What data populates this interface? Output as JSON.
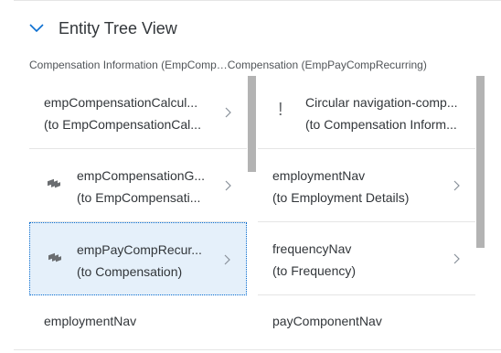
{
  "panel": {
    "title": "Entity Tree View",
    "breadcrumb": "Compensation Information (EmpComp…Compensation (EmpPayCompRecurring)"
  },
  "left_items": [
    {
      "line1": "empCompensationCalcul...",
      "line2": "(to EmpCompensationCal...",
      "icon": "none"
    },
    {
      "line1": "empCompensationG...",
      "line2": "(to EmpCompensati...",
      "icon": "hierarchy-icon"
    },
    {
      "line1": "empPayCompRecur...",
      "line2": "(to Compensation)",
      "icon": "hierarchy-icon",
      "selected": true
    }
  ],
  "right_items": [
    {
      "line1": "Circular navigation-comp...",
      "line2": "(to Compensation Inform...",
      "icon": "warning-exclamation-icon"
    },
    {
      "line1": "employmentNav",
      "line2": "(to Employment Details)",
      "icon": "none"
    },
    {
      "line1": "frequencyNav",
      "line2": "(to Frequency)",
      "icon": "none"
    }
  ],
  "bottom_left": "employmentNav",
  "bottom_right": "payComponentNav",
  "colors": {
    "selected_bg": "#e5f0fa",
    "selected_border": "#0a6ed1",
    "accent": "#0a6ed1"
  }
}
